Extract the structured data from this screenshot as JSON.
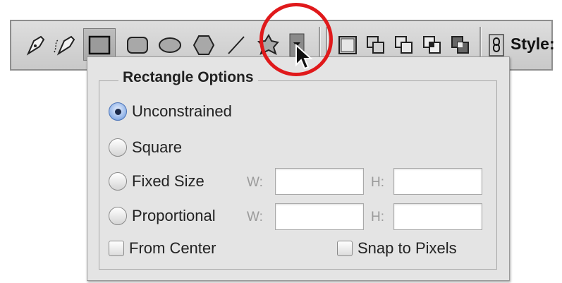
{
  "toolbar": {
    "tools": [
      {
        "icon": "pen-tool-icon"
      },
      {
        "icon": "freeform-pen-tool-icon"
      },
      {
        "icon": "rectangle-tool-icon",
        "selected": true
      },
      {
        "icon": "rounded-rectangle-tool-icon"
      },
      {
        "icon": "ellipse-tool-icon"
      },
      {
        "icon": "polygon-tool-icon"
      },
      {
        "icon": "line-tool-icon"
      },
      {
        "icon": "custom-shape-tool-icon"
      },
      {
        "icon": "geometry-options-dropdown-icon"
      }
    ],
    "modes": [
      {
        "icon": "create-new-shape-layer-icon"
      },
      {
        "icon": "add-to-shape-area-icon"
      },
      {
        "icon": "subtract-from-shape-area-icon"
      },
      {
        "icon": "intersect-shape-areas-icon"
      },
      {
        "icon": "exclude-overlapping-shape-areas-icon"
      }
    ],
    "link_icon": "link-layer-style-icon",
    "style_label": "Style:"
  },
  "popup": {
    "title": "Rectangle Options",
    "options": [
      {
        "label": "Unconstrained",
        "checked": true
      },
      {
        "label": "Square",
        "checked": false
      },
      {
        "label": "Fixed Size",
        "checked": false
      },
      {
        "label": "Proportional",
        "checked": false
      }
    ],
    "fixed_size": {
      "w_label": "W:",
      "h_label": "H:",
      "w_value": "",
      "h_value": ""
    },
    "proportional": {
      "w_label": "W:",
      "h_label": "H:",
      "w_value": "",
      "h_value": ""
    },
    "checkboxes": [
      {
        "label": "From Center",
        "checked": false
      },
      {
        "label": "Snap to Pixels",
        "checked": false
      }
    ]
  },
  "colors": {
    "highlight_circle": "#e0191b",
    "radio_selected": "#5f88cf"
  }
}
